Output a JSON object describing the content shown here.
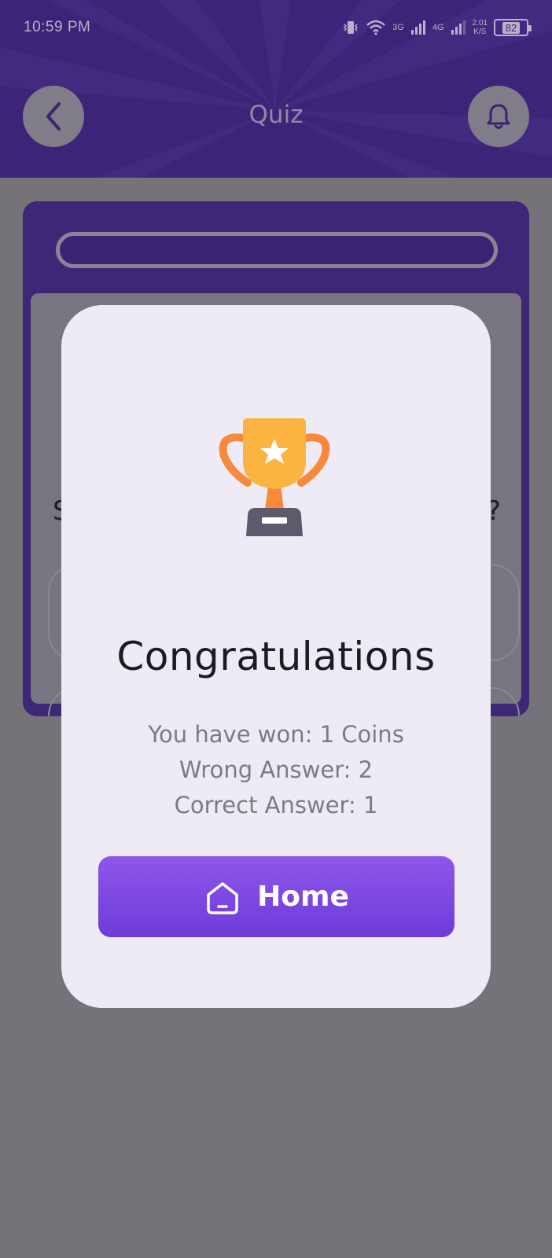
{
  "status_bar": {
    "time": "10:59 PM",
    "net1": "3G",
    "net2": "4G",
    "speed_value": "2.01",
    "speed_unit": "K/S",
    "battery": "82"
  },
  "header": {
    "title": "Quiz",
    "back_icon": "chevron-left-icon",
    "bell_icon": "bell-icon"
  },
  "quiz": {
    "question_start": "S",
    "question_end": "?"
  },
  "modal": {
    "icon": "trophy-icon",
    "title": "Congratulations",
    "coins_line": "You have won: 1 Coins",
    "wrong_line": "Wrong Answer: 2",
    "correct_line": "Correct Answer: 1",
    "home_button_label": "Home",
    "home_icon": "home-icon"
  },
  "colors": {
    "header_bg": "#3c2478",
    "modal_bg": "#eeeaf6",
    "button_top": "#8f56ea",
    "button_bottom": "#6e3bd8",
    "trophy_gold": "#fbb341",
    "trophy_orange": "#f6893c",
    "overlay": "#75727a"
  }
}
